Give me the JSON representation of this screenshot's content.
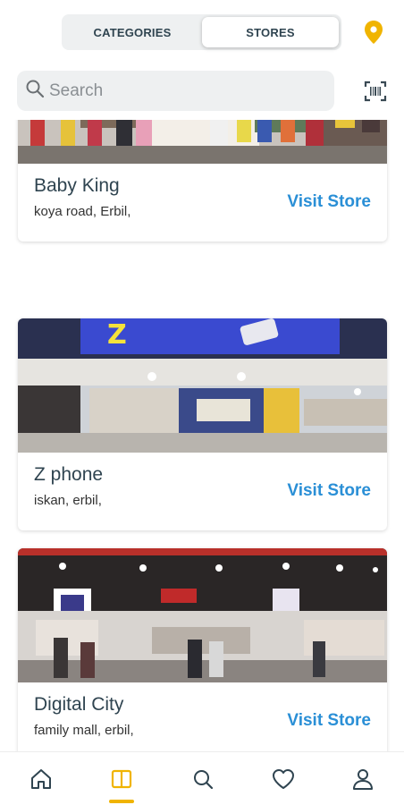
{
  "tabs": {
    "categories_label": "CATEGORIES",
    "stores_label": "STORES",
    "active": "STORES"
  },
  "search": {
    "placeholder": "Search"
  },
  "colors": {
    "accent_yellow": "#f0b400",
    "link_blue": "#2a8fd6",
    "text_dark": "#2f4450"
  },
  "stores": [
    {
      "name": "Baby King",
      "address": "koya road, Erbil,",
      "action_label": "Visit Store"
    },
    {
      "name": "Z phone",
      "address": "iskan, erbil,",
      "action_label": "Visit Store"
    },
    {
      "name": "Digital City",
      "address": "family mall, erbil,",
      "action_label": "Visit Store"
    }
  ],
  "bottom_nav": [
    {
      "icon": "home-icon"
    },
    {
      "icon": "stores-icon",
      "active": true
    },
    {
      "icon": "search-icon"
    },
    {
      "icon": "heart-icon"
    },
    {
      "icon": "profile-icon"
    }
  ]
}
